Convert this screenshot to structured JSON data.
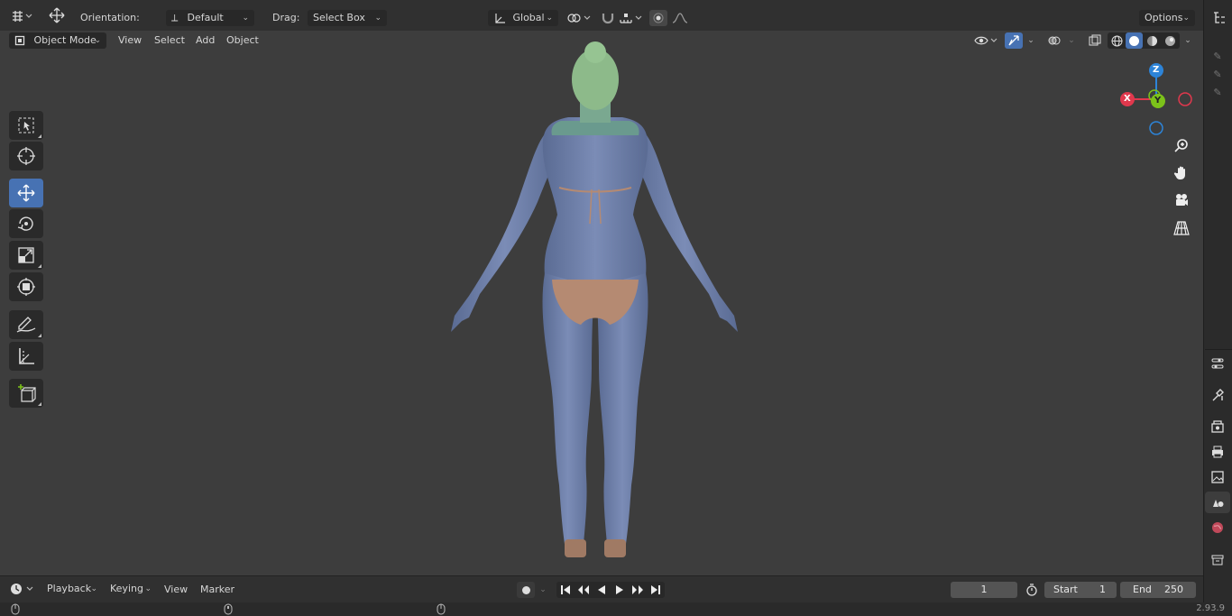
{
  "tool_header": {
    "orientation_label": "Orientation:",
    "orientation_value": "Default",
    "drag_label": "Drag:",
    "drag_value": "Select Box",
    "transform_orientation": "Global",
    "options_label": "Options"
  },
  "view_header": {
    "mode": "Object Mode",
    "menus": [
      "View",
      "Select",
      "Add",
      "Object"
    ]
  },
  "toolbar": {
    "tools": [
      "select-box",
      "cursor",
      "move",
      "rotate",
      "scale",
      "transform",
      "annotate",
      "measure",
      "add-cube"
    ],
    "active_tool": "move"
  },
  "nav_gizmo": {
    "axes": [
      "X",
      "Y",
      "Z"
    ],
    "colors": {
      "x": "#e0384d",
      "y": "#7cc21a",
      "z": "#2d84d8"
    },
    "buttons": [
      "zoom-icon",
      "hand-pan-icon",
      "camera-icon",
      "perspective-grid-icon"
    ]
  },
  "timeline": {
    "menus": [
      "Playback",
      "Keying",
      "View",
      "Marker"
    ],
    "current_frame": "1",
    "start_label": "Start",
    "start_value": "1",
    "end_label": "End",
    "end_value": "250"
  },
  "status": {
    "version": "2.93.9"
  },
  "colors": {
    "active_blue": "#4772b3",
    "skin": "#6f80aa",
    "hair": "#8dba8a",
    "bikini": "#b58a72"
  }
}
